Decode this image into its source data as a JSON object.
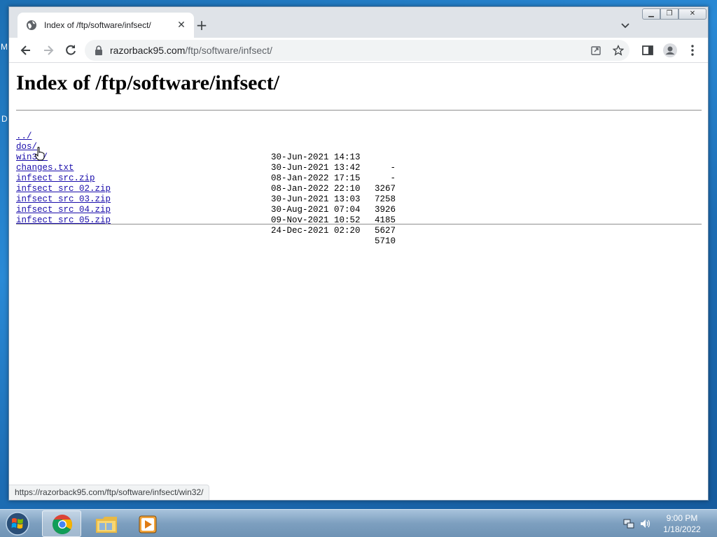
{
  "desktop": {
    "peek_letters": [
      "M",
      "D"
    ]
  },
  "browser": {
    "tab": {
      "title": "Index of /ftp/software/infsect/"
    },
    "address": {
      "host": "razorback95.com",
      "path": "/ftp/software/infsect/"
    },
    "status_url": "https://razorback95.com/ftp/software/infsect/win32/"
  },
  "page": {
    "heading": "Index of /ftp/software/infsect/",
    "entries": [
      {
        "name": "../",
        "date": "",
        "size": ""
      },
      {
        "name": "dos/",
        "date": "30-Jun-2021 14:13",
        "size": "-"
      },
      {
        "name": "win32/",
        "date": "30-Jun-2021 13:42",
        "size": "-"
      },
      {
        "name": "changes.txt",
        "date": "08-Jan-2022 17:15",
        "size": "3267"
      },
      {
        "name": "infsect_src.zip",
        "date": "08-Jan-2022 22:10",
        "size": "7258"
      },
      {
        "name": "infsect_src_02.zip",
        "date": "30-Jun-2021 13:03",
        "size": "3926"
      },
      {
        "name": "infsect_src_03.zip",
        "date": "30-Aug-2021 07:04",
        "size": "4185"
      },
      {
        "name": "infsect_src_04.zip",
        "date": "09-Nov-2021 10:52",
        "size": "5627"
      },
      {
        "name": "infsect_src_05.zip",
        "date": "24-Dec-2021 02:20",
        "size": "5710"
      }
    ]
  },
  "taskbar": {
    "apps": [
      "chrome-icon",
      "folder-icon",
      "media-player-icon"
    ],
    "clock": {
      "time": "9:00 PM",
      "date": "1/18/2022"
    }
  },
  "colors": {
    "link": "#1a0dab",
    "desktop": "#1c6fb3"
  }
}
